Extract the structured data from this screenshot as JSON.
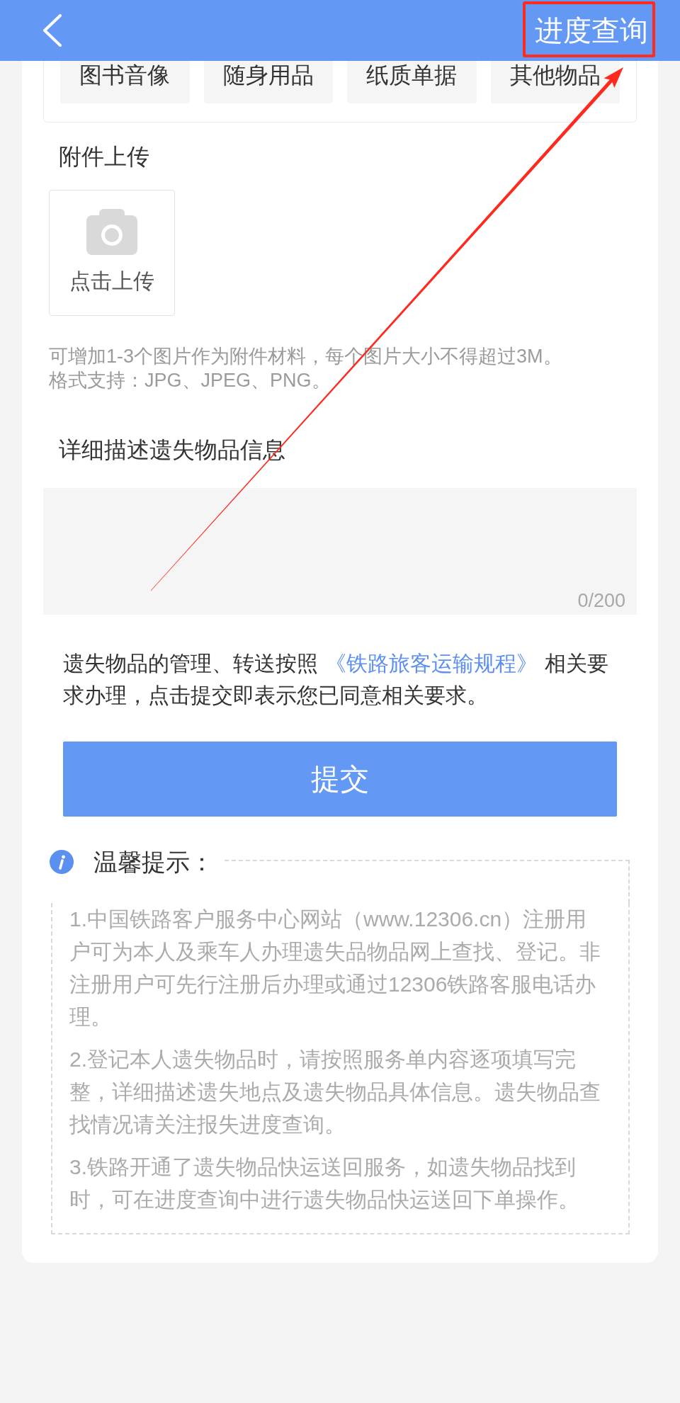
{
  "header": {
    "action": "进度查询"
  },
  "categories": [
    {
      "label": "图书音像",
      "selected": false
    },
    {
      "label": "随身用品",
      "selected": false
    },
    {
      "label": "纸质单据",
      "selected": false
    },
    {
      "label": "其他物品",
      "selected": false
    }
  ],
  "attachments": {
    "label": "附件上传",
    "upload": "点击上传",
    "hints": [
      "可增加1-3个图片作为附件材料，每个图片大小不得超过3M。",
      "格式支持：JPG、JPEG、PNG。"
    ]
  },
  "description": {
    "label": "详细描述遗失物品信息",
    "counter": "0/200"
  },
  "agreement": {
    "before": "遗失物品的管理、转送按照",
    "link": "《铁路旅客运输规程》",
    "after": "相关要求办理，点击提交即表示您已同意相关要求。"
  },
  "submit": "提交",
  "tips": {
    "title": "温馨提示：",
    "items": [
      "1.中国铁路客户服务中心网站（www.12306.cn）注册用户可为本人及乘车人办理遗失品物品网上查找、登记。非注册用户可先行注册后办理或通过12306铁路客服电话办理。",
      "2.登记本人遗失物品时，请按照服务单内容逐项填写完整，详细描述遗失地点及遗失物品具体信息。遗失物品查找情况请关注报失进度查询。",
      "3.铁路开通了遗失物品快运送回服务，如遗失物品找到时，可在进度查询中进行遗失物品快运送回下单操作。"
    ]
  },
  "annotations": {
    "highlight_frame": true,
    "arrow": true
  }
}
